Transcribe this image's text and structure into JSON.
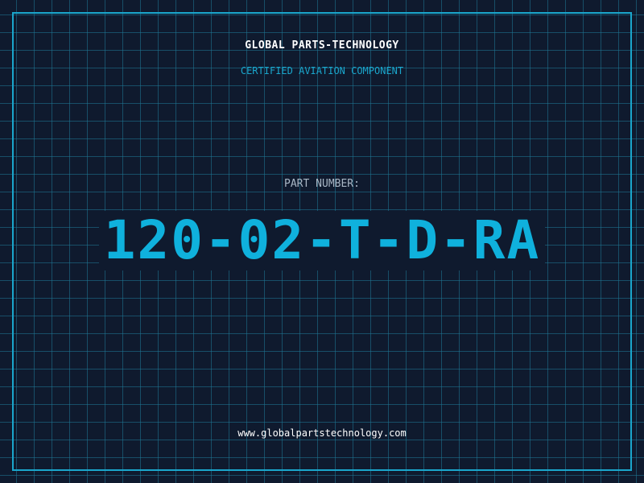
{
  "header": {
    "company_name": "GLOBAL PARTS-TECHNOLOGY",
    "certification": "CERTIFIED AVIATION COMPONENT"
  },
  "part": {
    "label": "PART NUMBER:",
    "number": "120-02-T-D-RA"
  },
  "footer": {
    "website": "www.globalpartstechnology.com"
  },
  "colors": {
    "background": "#0f1a2e",
    "grid": "#1e7896",
    "accent": "#1aa6cc",
    "part_number": "#0fb1dd",
    "label": "#a9b7c6",
    "text": "#ffffff"
  }
}
